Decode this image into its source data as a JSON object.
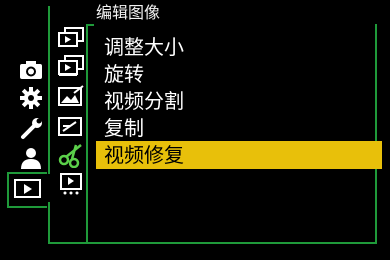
{
  "menu": {
    "title": "编辑图像",
    "items": [
      {
        "label": "调整大小"
      },
      {
        "label": "旋转"
      },
      {
        "label": "视频分割"
      },
      {
        "label": "复制"
      },
      {
        "label": "视频修复"
      }
    ],
    "selected_index": 4
  },
  "sidebar": {
    "categories": [
      {
        "icon": "camera-icon"
      },
      {
        "icon": "gear-icon"
      },
      {
        "icon": "wrench-icon"
      },
      {
        "icon": "person-icon"
      },
      {
        "icon": "playback-icon",
        "active": true
      }
    ]
  },
  "subtabs": [
    {
      "icon": "playback-mode-icon"
    },
    {
      "icon": "image-stack-icon"
    },
    {
      "icon": "image-edit-icon"
    },
    {
      "icon": "image-process-icon"
    },
    {
      "icon": "scissors-icon",
      "active": true
    },
    {
      "icon": "other-playback-icon"
    }
  ],
  "colors": {
    "accent_green": "#1f9a3a",
    "highlight_yellow": "#e8c00a"
  }
}
